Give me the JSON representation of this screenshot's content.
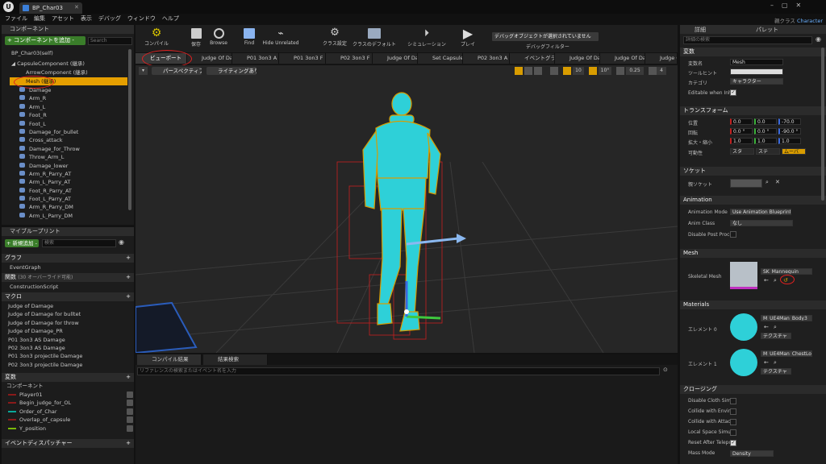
{
  "window": {
    "tab_title": "BP_Char03",
    "app_name": "Character",
    "project_label": "親クラス"
  },
  "menu": [
    "ファイル",
    "編集",
    "アセット",
    "表示",
    "デバッグ",
    "ウィンドウ",
    "ヘルプ"
  ],
  "components": {
    "header": "コンポーネント",
    "add_button": "+ コンポーネントを追加 -",
    "search_placeholder": "Search",
    "root": "BP_Char03(self)",
    "capsule": "CapsuleComponent (継承)",
    "arrow": "ArrowComponent (継承)",
    "mesh": "Mesh (継承)",
    "children": [
      "Damage",
      "Arm_R",
      "Arm_L",
      "Foot_R",
      "Foot_L",
      "Damage_for_bullet",
      "Cross_attack",
      "Damage_for_Throw",
      "Throw_Arm_L",
      "Damage_lower",
      "Arm_R_Parry_AT",
      "Arm_L_Parry_AT",
      "Foot_R_Parry_AT",
      "Foot_L_Parry_AT",
      "Arm_R_Parry_DM",
      "Arm_L_Parry_DM"
    ]
  },
  "my_blueprint": {
    "header": "マイブループリント",
    "add_new": "+ 新規追加 -",
    "search_placeholder": "検索",
    "graphs_label": "グラフ",
    "event_graph": "EventGraph",
    "functions_label": "関数",
    "functions_note": "(30 オーバーライド可能)",
    "construction": "ConstructionScript",
    "macros_label": "マクロ",
    "macros": [
      "Judge of Damage",
      "Judge of Damage for bulltet",
      "Judge of Damage for throw",
      "Judge of Damage_PR",
      "P01 3on3 AS Damage",
      "P02 3on3 AS Damage",
      "P01 3on3 projectile Damage",
      "P02 3on3 projectile Damage"
    ],
    "variables_label": "変数",
    "components_label": "コンポーネント",
    "variables": [
      {
        "name": "Player01",
        "color": "#8a1a1a"
      },
      {
        "name": "Begin_judge_for_OL",
        "color": "#8a1a1a"
      },
      {
        "name": "Order_of_Char",
        "color": "#0aa89a"
      },
      {
        "name": "Overlap_of_capsule",
        "color": "#8a1a1a"
      },
      {
        "name": "Y_position",
        "color": "#7ab80a"
      }
    ],
    "dispatchers_label": "イベントディスパッチャー"
  },
  "toolbar": {
    "buttons": [
      "コンパイル",
      "保存",
      "Browse",
      "Find",
      "Hide Unrelated",
      "クラス設定",
      "クラスのデフォルト",
      "シミュレーション",
      "プレイ"
    ],
    "debug_select": "デバッグオブジェクトが選択されていません",
    "debug_filter": "デバッグフィルター"
  },
  "graph_tabs": [
    "ビューポート",
    "Judge Of Da",
    "P01 3on3 A",
    "P01 3on3 F",
    "P02 3on3 F",
    "Judge Of Da",
    "Set Capsule",
    "P02 3on3 A",
    "イベントグラ",
    "Judge Of Da",
    "Judge Of Da",
    "Judge Of Da"
  ],
  "viewport": {
    "perspective": "パースペクティブ",
    "lighting": "ライティングあり",
    "grid_size": "10",
    "angle": "10°",
    "scale": "0.25",
    "cam_speed": "4"
  },
  "bottom": {
    "tab_compile": "コンパイル結果",
    "tab_search": "結果検索",
    "search_placeholder": "リファレンスの検索またはイベント名を入力"
  },
  "details": {
    "tab_details": "詳細",
    "tab_palette": "パレット",
    "search_placeholder": "詳細の検索",
    "sec_variable": "変数",
    "var_name_label": "変数名",
    "var_name": "Mesh",
    "tooltip_label": "ツールヒント",
    "category_label": "カテゴリ",
    "category": "キャラクター",
    "editable_label": "Editable when Inhe",
    "sec_transform": "トランスフォーム",
    "loc_label": "位置",
    "loc": [
      "0.0",
      "0.0",
      "-70.0"
    ],
    "rot_label": "回転",
    "rot": [
      "0.0 °",
      "0.0 °",
      "-90.0 °"
    ],
    "scale_label": "拡大・縮小",
    "scale": [
      "1.0",
      "1.0",
      "1.0"
    ],
    "mobility_label": "可動性",
    "mobility": [
      "スタ",
      "ステ",
      "ムーバ"
    ],
    "sec_socket": "ソケット",
    "parent_socket_label": "親ソケット",
    "sec_animation": "Animation",
    "anim_mode_label": "Animation Mode",
    "anim_mode": "Use Animation Blueprint",
    "anim_class_label": "Anim Class",
    "anim_class": "なし",
    "disable_post_label": "Disable Post Proce",
    "sec_mesh": "Mesh",
    "skel_label": "Skeletal Mesh",
    "skel_value": "SK_Mannequin",
    "sec_materials": "Materials",
    "elem0_label": "エレメント 0",
    "elem0_value": "M_UE4Man_Body3",
    "elem1_label": "エレメント 1",
    "elem1_value": "M_UE4Man_ChestLo",
    "texture_btn": "テクスチャ",
    "sec_clothing": "クロージング",
    "cloth_rows": [
      "Disable Cloth Simu",
      "Collide with Enviro",
      "Collide with Attach",
      "Local Space Simul",
      "Reset After Telepo",
      "Mass Mode"
    ],
    "mass_mode": "Density"
  },
  "colors": {
    "accent_orange": "#d89c00",
    "selected": "#e59f00",
    "annotation_red": "#e02020",
    "mannequin": "#2ed0d8"
  }
}
